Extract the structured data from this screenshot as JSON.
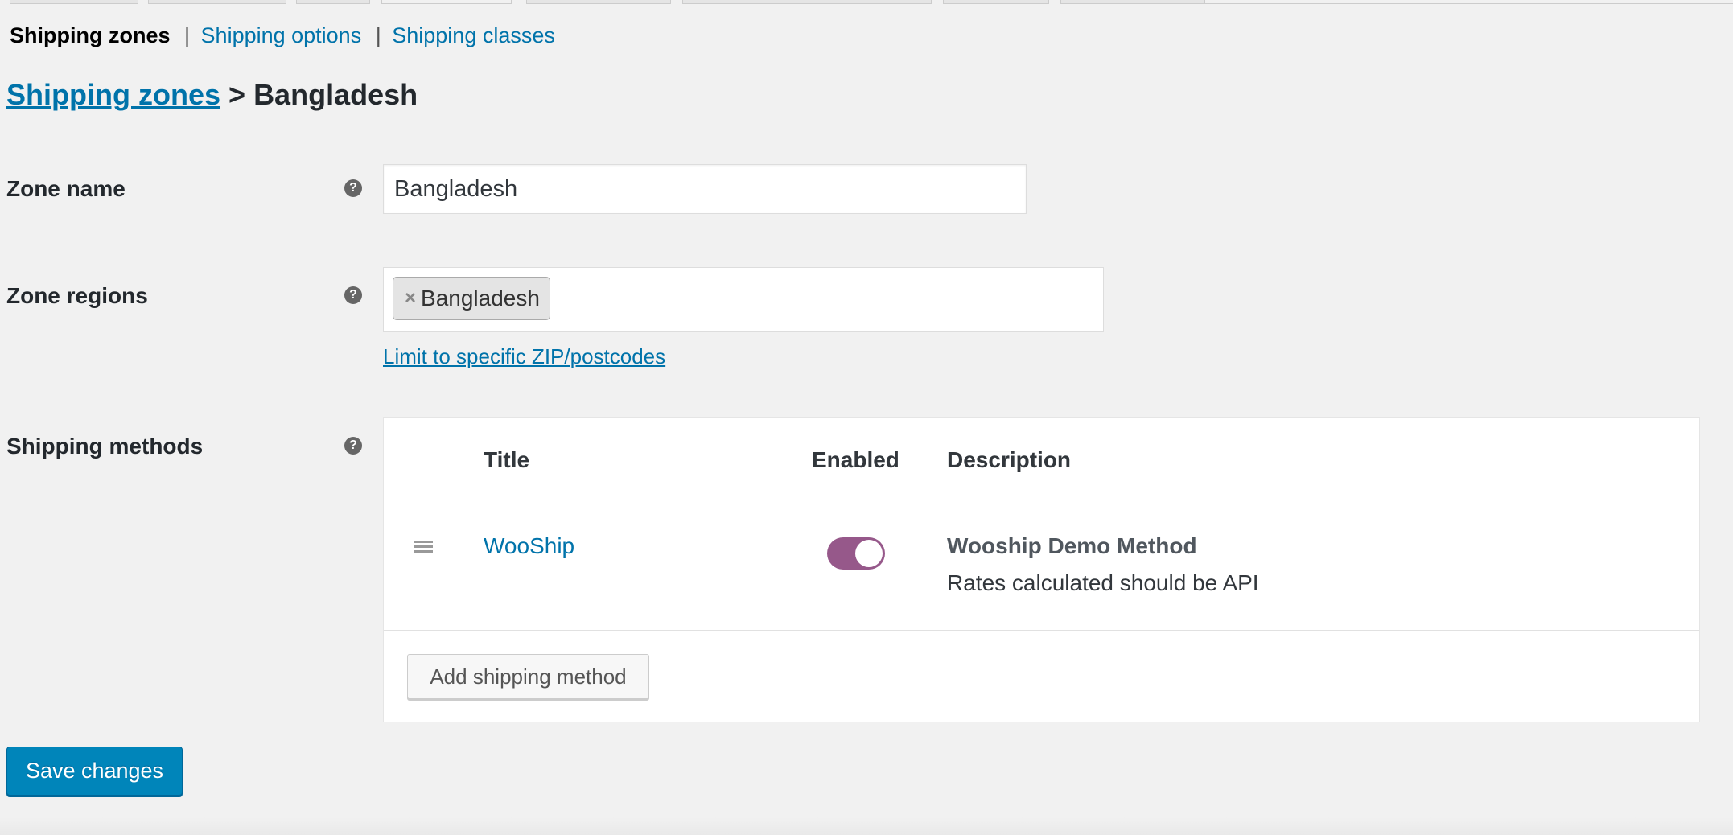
{
  "subnav": {
    "current": "Shipping zones",
    "separator": "|",
    "links": [
      "Shipping options",
      "Shipping classes"
    ]
  },
  "heading": {
    "link": "Shipping zones",
    "separator": ">",
    "zone": "Bangladesh"
  },
  "zone_name": {
    "label": "Zone name",
    "help_icon": "help-icon",
    "value": "Bangladesh"
  },
  "zone_regions": {
    "label": "Zone regions",
    "help_icon": "help-icon",
    "chips": [
      {
        "remove": "×",
        "label": "Bangladesh"
      }
    ],
    "limit_link": "Limit to specific ZIP/postcodes"
  },
  "shipping_methods": {
    "label": "Shipping methods",
    "help_icon": "help-icon",
    "columns": [
      "Title",
      "Enabled",
      "Description"
    ],
    "rows": [
      {
        "drag_icon": "drag-handle-icon",
        "title": "WooShip",
        "enabled": true,
        "description_title": "Wooship Demo Method",
        "description": "Rates calculated should be API"
      }
    ],
    "add_button": "Add shipping method"
  },
  "save_button": "Save changes",
  "colors": {
    "link": "#0073aa",
    "toggle_on": "#96588a",
    "primary_button": "#0085ba",
    "background": "#f1f1f1"
  }
}
